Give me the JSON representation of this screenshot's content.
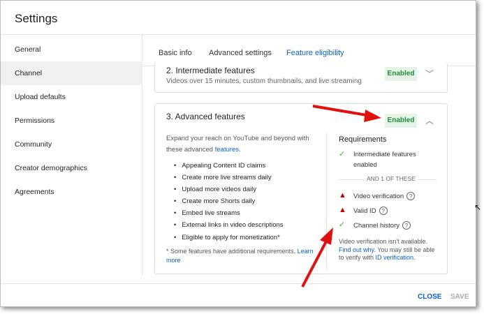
{
  "title": "Settings",
  "sidebar": {
    "items": [
      {
        "label": "General"
      },
      {
        "label": "Channel"
      },
      {
        "label": "Upload defaults"
      },
      {
        "label": "Permissions"
      },
      {
        "label": "Community"
      },
      {
        "label": "Creator demographics"
      },
      {
        "label": "Agreements"
      }
    ]
  },
  "tabs": [
    {
      "label": "Basic info"
    },
    {
      "label": "Advanced settings"
    },
    {
      "label": "Feature eligibility"
    }
  ],
  "intermediate": {
    "title": "2. Intermediate features",
    "subtitle": "Videos over 15 minutes, custom thumbnails, and live streaming",
    "status": "Enabled"
  },
  "advanced": {
    "title": "3. Advanced features",
    "status": "Enabled",
    "intro": "Expand your reach on YouTube and beyond with these advanced ",
    "intro_link": "features",
    "intro_end": ".",
    "features": [
      "Appealing Content ID claims",
      "Create more live streams daily",
      "Upload more videos daily",
      "Create more Shorts daily",
      "Embed live streams",
      "External links in video descriptions",
      "Eligible to apply for monetization*"
    ],
    "footnote": "* Some features have additional requirements. ",
    "footnote_link": "Learn more",
    "requirements": {
      "heading": "Requirements",
      "base": "Intermediate features enabled",
      "divider": "AND 1 OF THESE",
      "items": [
        {
          "label": "Video verification",
          "status": "warning"
        },
        {
          "label": "Valid ID",
          "status": "warning"
        },
        {
          "label": "Channel history",
          "status": "ok"
        }
      ],
      "note1": "Video verification isn't available. ",
      "note_link1": "Find out why.",
      "note2": " You may still be able to verify with ",
      "note_link2": "ID verification",
      "note3": "."
    }
  },
  "footer": {
    "close": "CLOSE",
    "save": "SAVE"
  },
  "colors": {
    "accent": "#065fd4",
    "enabled_bg": "#e6f4e7",
    "enabled_text": "#1e8e3e",
    "warning": "#cc0000",
    "arrow": "#e01010"
  }
}
